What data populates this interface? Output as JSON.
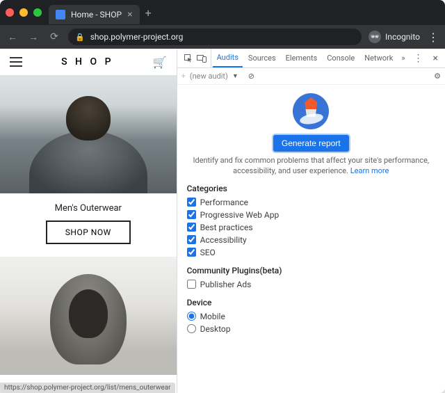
{
  "browser": {
    "tab_title": "Home - SHOP",
    "url_host": "shop.polymer-project.org",
    "incognito_label": "Incognito",
    "status_url": "https://shop.polymer-project.org/list/mens_outerwear"
  },
  "page": {
    "logo": "S H O P",
    "section_title": "Men's Outerwear",
    "shop_now": "SHOP NOW"
  },
  "devtools": {
    "tabs": [
      "Audits",
      "Sources",
      "Elements",
      "Console",
      "Network"
    ],
    "more_glyph": "»",
    "toolbar_label": "(new audit)",
    "generate_label": "Generate report",
    "blurb": "Identify and fix common problems that affect your site's performance, accessibility, and user experience.",
    "learn_more": "Learn more",
    "categories_heading": "Categories",
    "categories": [
      {
        "label": "Performance",
        "checked": true
      },
      {
        "label": "Progressive Web App",
        "checked": true
      },
      {
        "label": "Best practices",
        "checked": true
      },
      {
        "label": "Accessibility",
        "checked": true
      },
      {
        "label": "SEO",
        "checked": true
      }
    ],
    "plugins_heading": "Community Plugins(beta)",
    "plugins": [
      {
        "label": "Publisher Ads",
        "checked": false
      }
    ],
    "device_heading": "Device",
    "devices": [
      {
        "label": "Mobile",
        "selected": true
      },
      {
        "label": "Desktop",
        "selected": false
      }
    ]
  }
}
